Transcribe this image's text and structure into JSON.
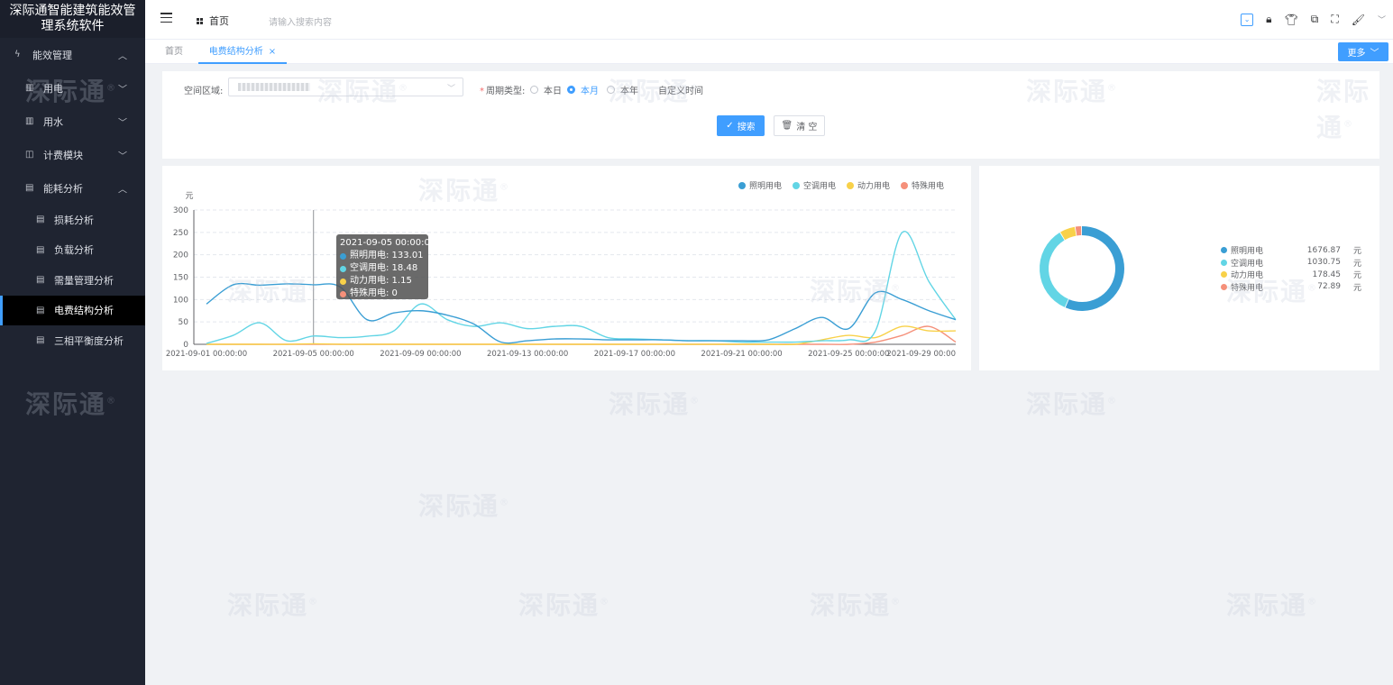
{
  "app": {
    "title": "深际通智能建筑能效管理系统软件"
  },
  "sidebar": {
    "items": [
      {
        "label": "能效管理",
        "level": 1,
        "expanded": true
      },
      {
        "label": "用电",
        "level": 2,
        "expanded": false
      },
      {
        "label": "用水",
        "level": 2,
        "expanded": false
      },
      {
        "label": "计费模块",
        "level": 2,
        "expanded": false
      },
      {
        "label": "能耗分析",
        "level": 2,
        "expanded": true
      },
      {
        "label": "损耗分析",
        "level": 3
      },
      {
        "label": "负载分析",
        "level": 3
      },
      {
        "label": "需量管理分析",
        "level": 3
      },
      {
        "label": "电费结构分析",
        "level": 3,
        "active": true
      },
      {
        "label": "三相平衡度分析",
        "level": 3
      }
    ]
  },
  "header": {
    "home_label": "首页",
    "search_placeholder": "请输入搜索内容"
  },
  "tabs": {
    "items": [
      {
        "label": "首页"
      },
      {
        "label": "电费结构分析",
        "active": true,
        "close": "×"
      }
    ],
    "more_label": "更多"
  },
  "filter": {
    "area_label": "空间区域:",
    "period_label": "周期类型:",
    "required_mark": "*",
    "period_options": [
      {
        "label": "本日",
        "selected": false
      },
      {
        "label": "本月",
        "selected": true
      },
      {
        "label": "本年",
        "selected": false
      },
      {
        "label": "自定义时间",
        "selected": false
      }
    ],
    "search_label": "搜索",
    "clear_label": "清 空"
  },
  "colors": {
    "lighting": "#3a9ed4",
    "aircon": "#62d5e5",
    "power": "#f8d149",
    "special": "#f5907a",
    "accent": "#409eff"
  },
  "chart_data": [
    {
      "type": "line",
      "ylabel": "元",
      "ylim": [
        0,
        300
      ],
      "yticks": [
        0,
        50,
        100,
        150,
        200,
        250,
        300
      ],
      "x": [
        "2021-09-01 00:00:00",
        "2021-09-02 00:00:00",
        "2021-09-03 00:00:00",
        "2021-09-04 00:00:00",
        "2021-09-05 00:00:00",
        "2021-09-06 00:00:00",
        "2021-09-07 00:00:00",
        "2021-09-08 00:00:00",
        "2021-09-09 00:00:00",
        "2021-09-10 00:00:00",
        "2021-09-11 00:00:00",
        "2021-09-12 00:00:00",
        "2021-09-13 00:00:00",
        "2021-09-14 00:00:00",
        "2021-09-15 00:00:00",
        "2021-09-16 00:00:00",
        "2021-09-17 00:00:00",
        "2021-09-18 00:00:00",
        "2021-09-19 00:00:00",
        "2021-09-20 00:00:00",
        "2021-09-21 00:00:00",
        "2021-09-22 00:00:00",
        "2021-09-23 00:00:00",
        "2021-09-24 00:00:00",
        "2021-09-25 00:00:00",
        "2021-09-26 00:00:00",
        "2021-09-27 00:00:00",
        "2021-09-28 00:00:00",
        "2021-09-29 00:00:00"
      ],
      "xtick_labels": [
        "2021-09-01 00:00:00",
        "2021-09-05 00:00:00",
        "2021-09-09 00:00:00",
        "2021-09-13 00:00:00",
        "2021-09-17 00:00:00",
        "2021-09-21 00:00:00",
        "2021-09-25 00:00:00",
        "2021-09-29 00:00"
      ],
      "legend_position": "top-right",
      "series": [
        {
          "name": "照明用电",
          "color": "#3a9ed4",
          "values": [
            90,
            133,
            132,
            135,
            133,
            128,
            55,
            70,
            75,
            65,
            45,
            5,
            8,
            12,
            12,
            10,
            10,
            10,
            8,
            8,
            8,
            10,
            35,
            60,
            35,
            115,
            100,
            75,
            55
          ]
        },
        {
          "name": "空调用电",
          "color": "#62d5e5",
          "values": [
            2,
            20,
            48,
            8,
            18.48,
            15,
            18,
            30,
            90,
            55,
            40,
            48,
            35,
            40,
            40,
            15,
            12,
            10,
            8,
            8,
            5,
            5,
            5,
            8,
            10,
            30,
            250,
            140,
            55
          ]
        },
        {
          "name": "动力用电",
          "color": "#f8d149",
          "values": [
            0,
            0,
            0,
            0,
            1.15,
            0,
            0,
            0,
            0,
            0,
            0,
            0,
            0,
            0,
            0,
            0,
            0,
            0,
            0,
            0,
            0,
            0,
            0,
            10,
            20,
            15,
            40,
            30,
            30
          ]
        },
        {
          "name": "特殊用电",
          "color": "#f5907a",
          "values": [
            0,
            0,
            0,
            0,
            0,
            0,
            0,
            0,
            0,
            0,
            0,
            0,
            0,
            0,
            0,
            0,
            0,
            0,
            0,
            0,
            0,
            0,
            0,
            0,
            0,
            5,
            20,
            40,
            5
          ]
        }
      ],
      "tooltip": {
        "title": "2021-09-05 00:00:00",
        "rows": [
          {
            "text": "照明用电: 133.01",
            "color": "#3a9ed4"
          },
          {
            "text": "空调用电: 18.48",
            "color": "#62d5e5"
          },
          {
            "text": "动力用电: 1.15",
            "color": "#f8d149"
          },
          {
            "text": "特殊用电: 0",
            "color": "#f5907a"
          }
        ]
      }
    },
    {
      "type": "pie",
      "unit": "元",
      "slices": [
        {
          "name": "照明用电",
          "value": 1676.87,
          "value_text": "1676.87",
          "color": "#3a9ed4"
        },
        {
          "name": "空调用电",
          "value": 1030.75,
          "value_text": "1030.75",
          "color": "#62d5e5"
        },
        {
          "name": "动力用电",
          "value": 178.45,
          "value_text": "178.45",
          "color": "#f8d149"
        },
        {
          "name": "特殊用电",
          "value": 72.89,
          "value_text": "72.89",
          "color": "#f5907a"
        }
      ]
    }
  ],
  "watermark": {
    "text": "深际通",
    "mark": "®"
  }
}
